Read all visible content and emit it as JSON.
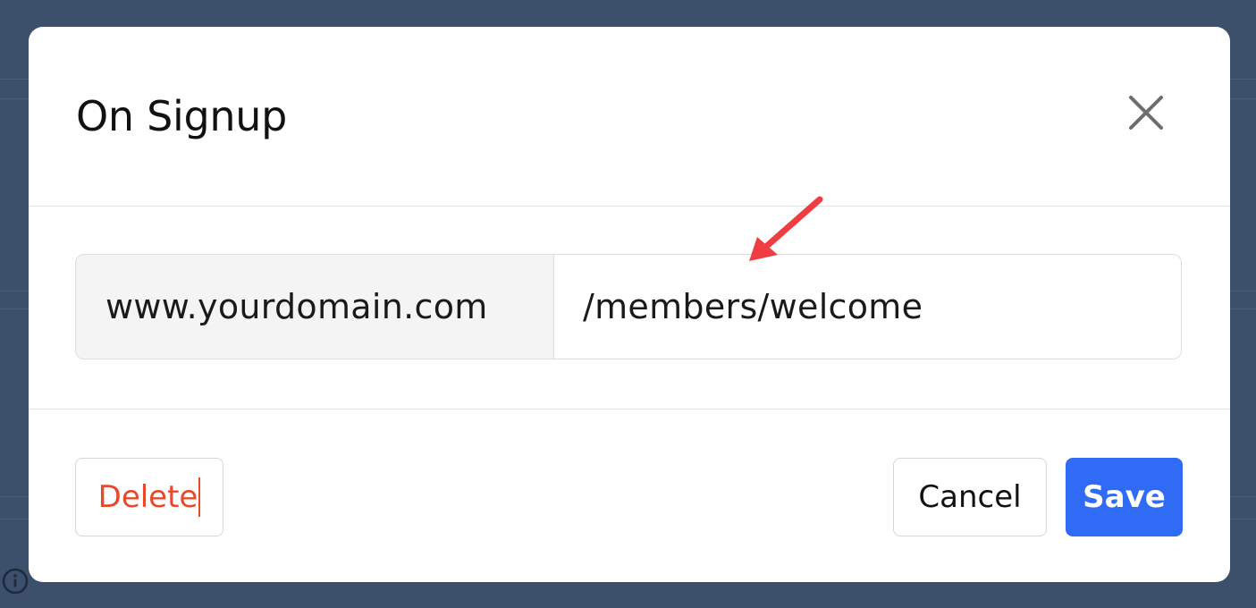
{
  "dialog": {
    "title": "On Signup",
    "close_icon": "close-icon"
  },
  "url_field": {
    "domain_prefix": "www.yourdomain.com",
    "path_value": "/members/welcome"
  },
  "annotation": {
    "icon": "red-arrow-icon",
    "color": "#ef3e42"
  },
  "footer": {
    "delete_label": "Delete",
    "cancel_label": "Cancel",
    "save_label": "Save"
  },
  "background": {
    "icon": "info-icon"
  },
  "colors": {
    "backdrop": "#3d506b",
    "delete_text": "#e8492a",
    "save_button": "#2f6bf5"
  }
}
